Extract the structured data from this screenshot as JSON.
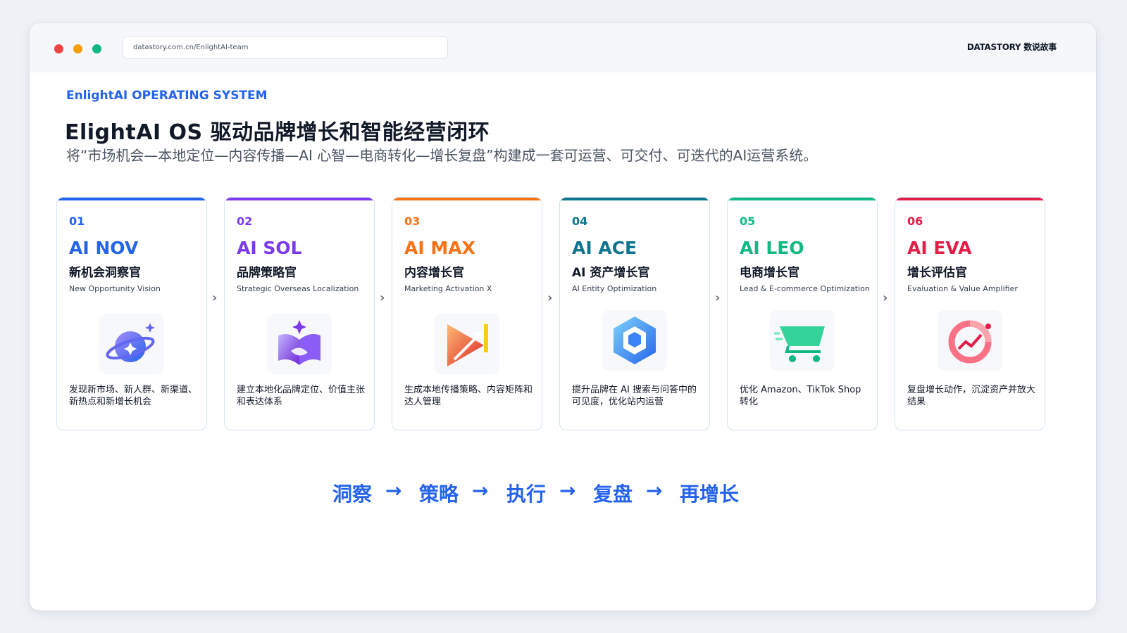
{
  "browser": {
    "url": "datastory.com.cn/EnlightAI-team",
    "brand": "DATASTORY 数说故事"
  },
  "hero": {
    "kicker": "EnlightAI OPERATING SYSTEM",
    "title": "ElightAI OS 驱动品牌增长和智能经营闭环",
    "subtitle": "将“市场机会—本地定位—内容传播—AI 心智—电商转化—增长复盘”构建成一套可运营、可交付、可迭代的AI运营系统。"
  },
  "cards": [
    {
      "num": "01",
      "code": "AI NOV",
      "role": "新机会洞察官",
      "en": "New Opportunity Vision",
      "desc": "发现新市场、新人群、新渠道、新热点和新增长机会",
      "color": "#2563eb",
      "icon": "planet-icon"
    },
    {
      "num": "02",
      "code": "AI SOL",
      "role": "品牌策略官",
      "en": "Strategic Overseas Localization",
      "desc": "建立本地化品牌定位、价值主张和表达体系",
      "color": "#7c3aed",
      "icon": "book-sparkle-icon"
    },
    {
      "num": "03",
      "code": "AI MAX",
      "role": "内容增长官",
      "en": "Marketing Activation X",
      "desc": "生成本地传播策略、内容矩阵和达人管理",
      "color": "#f97316",
      "icon": "play-growth-icon"
    },
    {
      "num": "04",
      "code": "AI ACE",
      "role": "AI 资产增长官",
      "en": "AI Entity Optimization",
      "desc": "提升品牌在 AI 搜索与问答中的可见度，优化站内运营",
      "color": "#0e7490",
      "icon": "hexagon-cube-icon"
    },
    {
      "num": "05",
      "code": "AI LEO",
      "role": "电商增长官",
      "en": "Lead & E-commerce Optimization",
      "desc": "优化 Amazon、TikTok Shop 转化",
      "color": "#10b981",
      "icon": "shopping-cart-icon"
    },
    {
      "num": "06",
      "code": "AI EVA",
      "role": "增长评估官",
      "en": "Evaluation & Value Amplifier",
      "desc": "复盘增长动作，沉淀资产并放大结果",
      "color": "#e11d48",
      "icon": "growth-ring-icon"
    }
  ],
  "flow": {
    "steps": [
      "洞察",
      "策略",
      "执行",
      "复盘",
      "再增长"
    ],
    "arrow": "→"
  },
  "chevron": "›"
}
